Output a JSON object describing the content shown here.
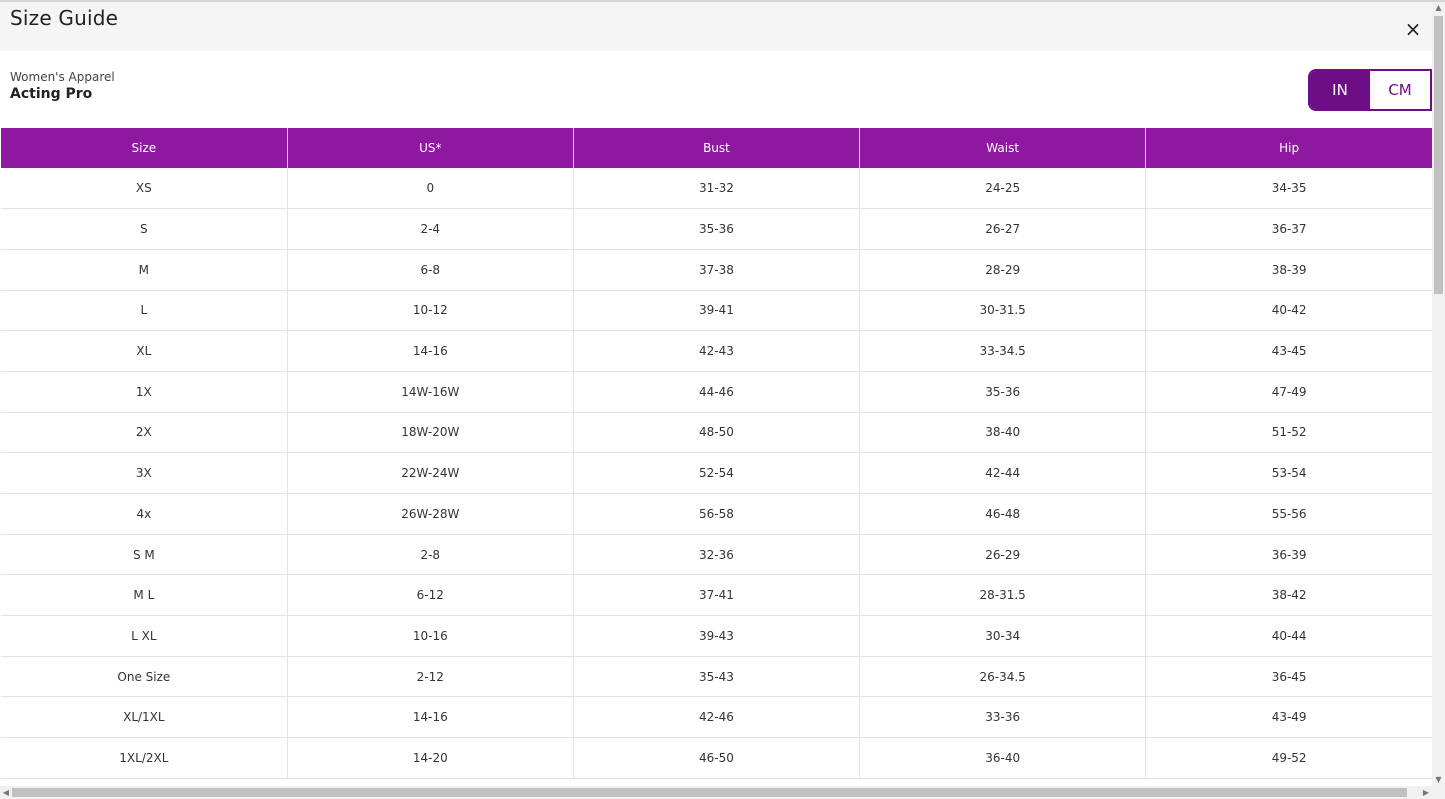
{
  "header": {
    "title": "Size Guide",
    "close_icon": "×"
  },
  "subtitle": {
    "category": "Women's Apparel",
    "product": "Acting Pro"
  },
  "unit_toggle": {
    "options": [
      "IN",
      "CM"
    ],
    "selected": "IN"
  },
  "colors": {
    "accent": "#8e18a0",
    "toggle": "#6d0e86"
  },
  "table": {
    "columns": [
      "Size",
      "US*",
      "Bust",
      "Waist",
      "Hip"
    ],
    "rows": [
      [
        "XS",
        "0",
        "31-32",
        "24-25",
        "34-35"
      ],
      [
        "S",
        "2-4",
        "35-36",
        "26-27",
        "36-37"
      ],
      [
        "M",
        "6-8",
        "37-38",
        "28-29",
        "38-39"
      ],
      [
        "L",
        "10-12",
        "39-41",
        "30-31.5",
        "40-42"
      ],
      [
        "XL",
        "14-16",
        "42-43",
        "33-34.5",
        "43-45"
      ],
      [
        "1X",
        "14W-16W",
        "44-46",
        "35-36",
        "47-49"
      ],
      [
        "2X",
        "18W-20W",
        "48-50",
        "38-40",
        "51-52"
      ],
      [
        "3X",
        "22W-24W",
        "52-54",
        "42-44",
        "53-54"
      ],
      [
        "4x",
        "26W-28W",
        "56-58",
        "46-48",
        "55-56"
      ],
      [
        "S M",
        "2-8",
        "32-36",
        "26-29",
        "36-39"
      ],
      [
        "M L",
        "6-12",
        "37-41",
        "28-31.5",
        "38-42"
      ],
      [
        "L XL",
        "10-16",
        "39-43",
        "30-34",
        "40-44"
      ],
      [
        "One Size",
        "2-12",
        "35-43",
        "26-34.5",
        "36-45"
      ],
      [
        "XL/1XL",
        "14-16",
        "42-46",
        "33-36",
        "43-49"
      ],
      [
        "1XL/2XL",
        "14-20",
        "46-50",
        "36-40",
        "49-52"
      ]
    ]
  }
}
